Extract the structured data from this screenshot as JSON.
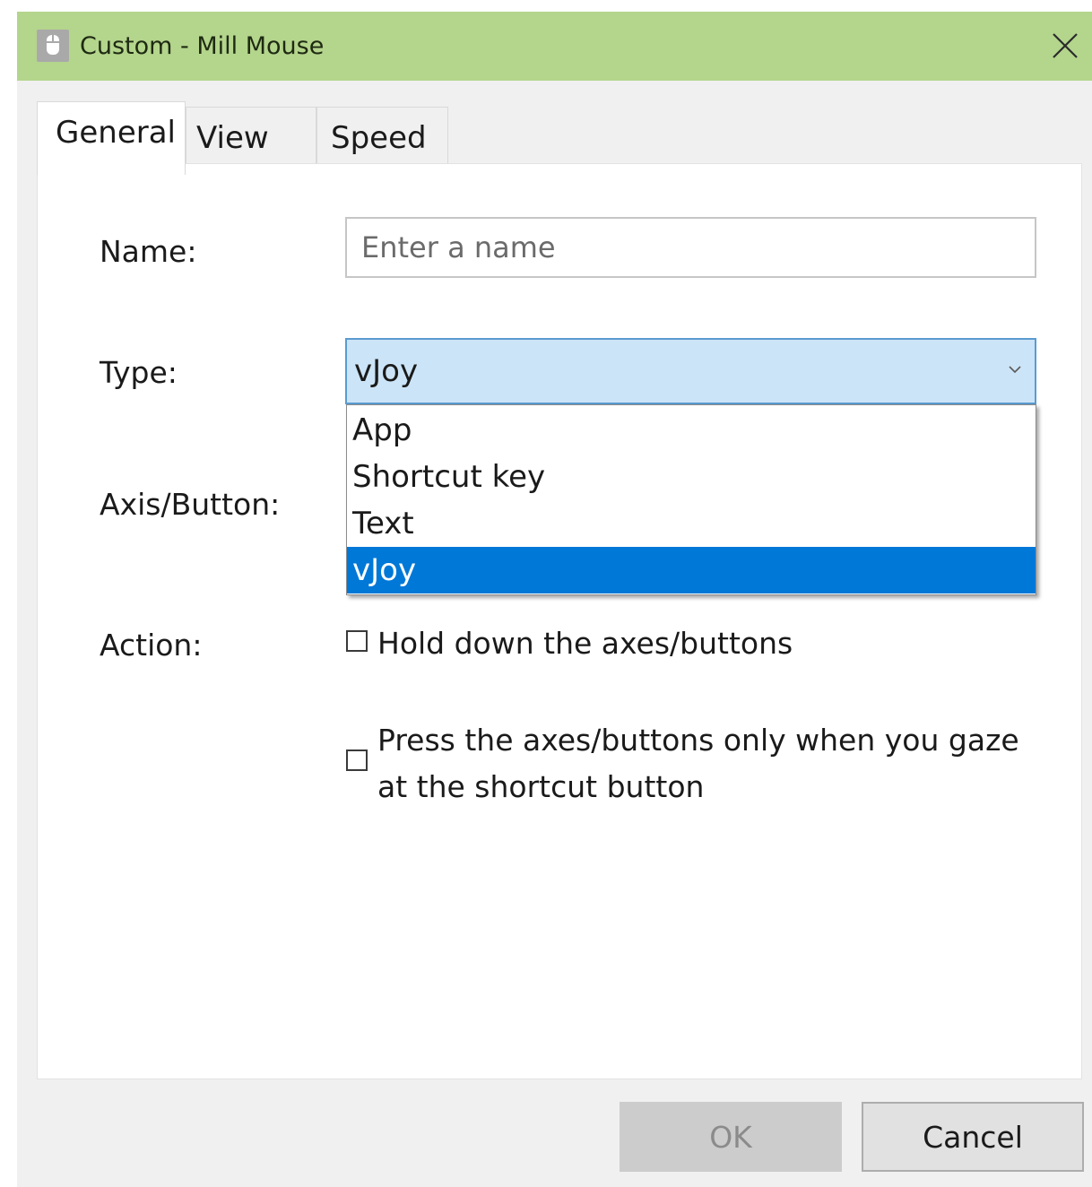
{
  "window": {
    "title": "Custom - Mill Mouse",
    "titlebar_color": "#b4d58c"
  },
  "icons": {
    "app": "mouse-icon",
    "close": "close-icon",
    "dropdown": "chevron-down-icon"
  },
  "tabs": [
    {
      "label": "General",
      "active": true
    },
    {
      "label": "View",
      "active": false
    },
    {
      "label": "Speed",
      "active": false
    }
  ],
  "form": {
    "name_label": "Name:",
    "name_placeholder": "Enter a name",
    "name_value": "",
    "type_label": "Type:",
    "type_value": "vJoy",
    "type_options": [
      {
        "label": "App",
        "selected": false
      },
      {
        "label": "Shortcut key",
        "selected": false
      },
      {
        "label": "Text",
        "selected": false
      },
      {
        "label": "vJoy",
        "selected": true
      }
    ],
    "axis_button_label": "Axis/Button:",
    "action_label": "Action:",
    "hold_down": {
      "label": "Hold down the axes/buttons",
      "checked": false
    },
    "gaze_only": {
      "line1": "Press the axes/buttons only when you gaze",
      "line2": "at the shortcut button",
      "checked": false
    }
  },
  "buttons": {
    "ok": {
      "label": "OK",
      "enabled": false
    },
    "cancel": {
      "label": "Cancel",
      "enabled": true
    }
  },
  "colors": {
    "selection": "#0078d7",
    "select_background": "#cce4f7"
  }
}
